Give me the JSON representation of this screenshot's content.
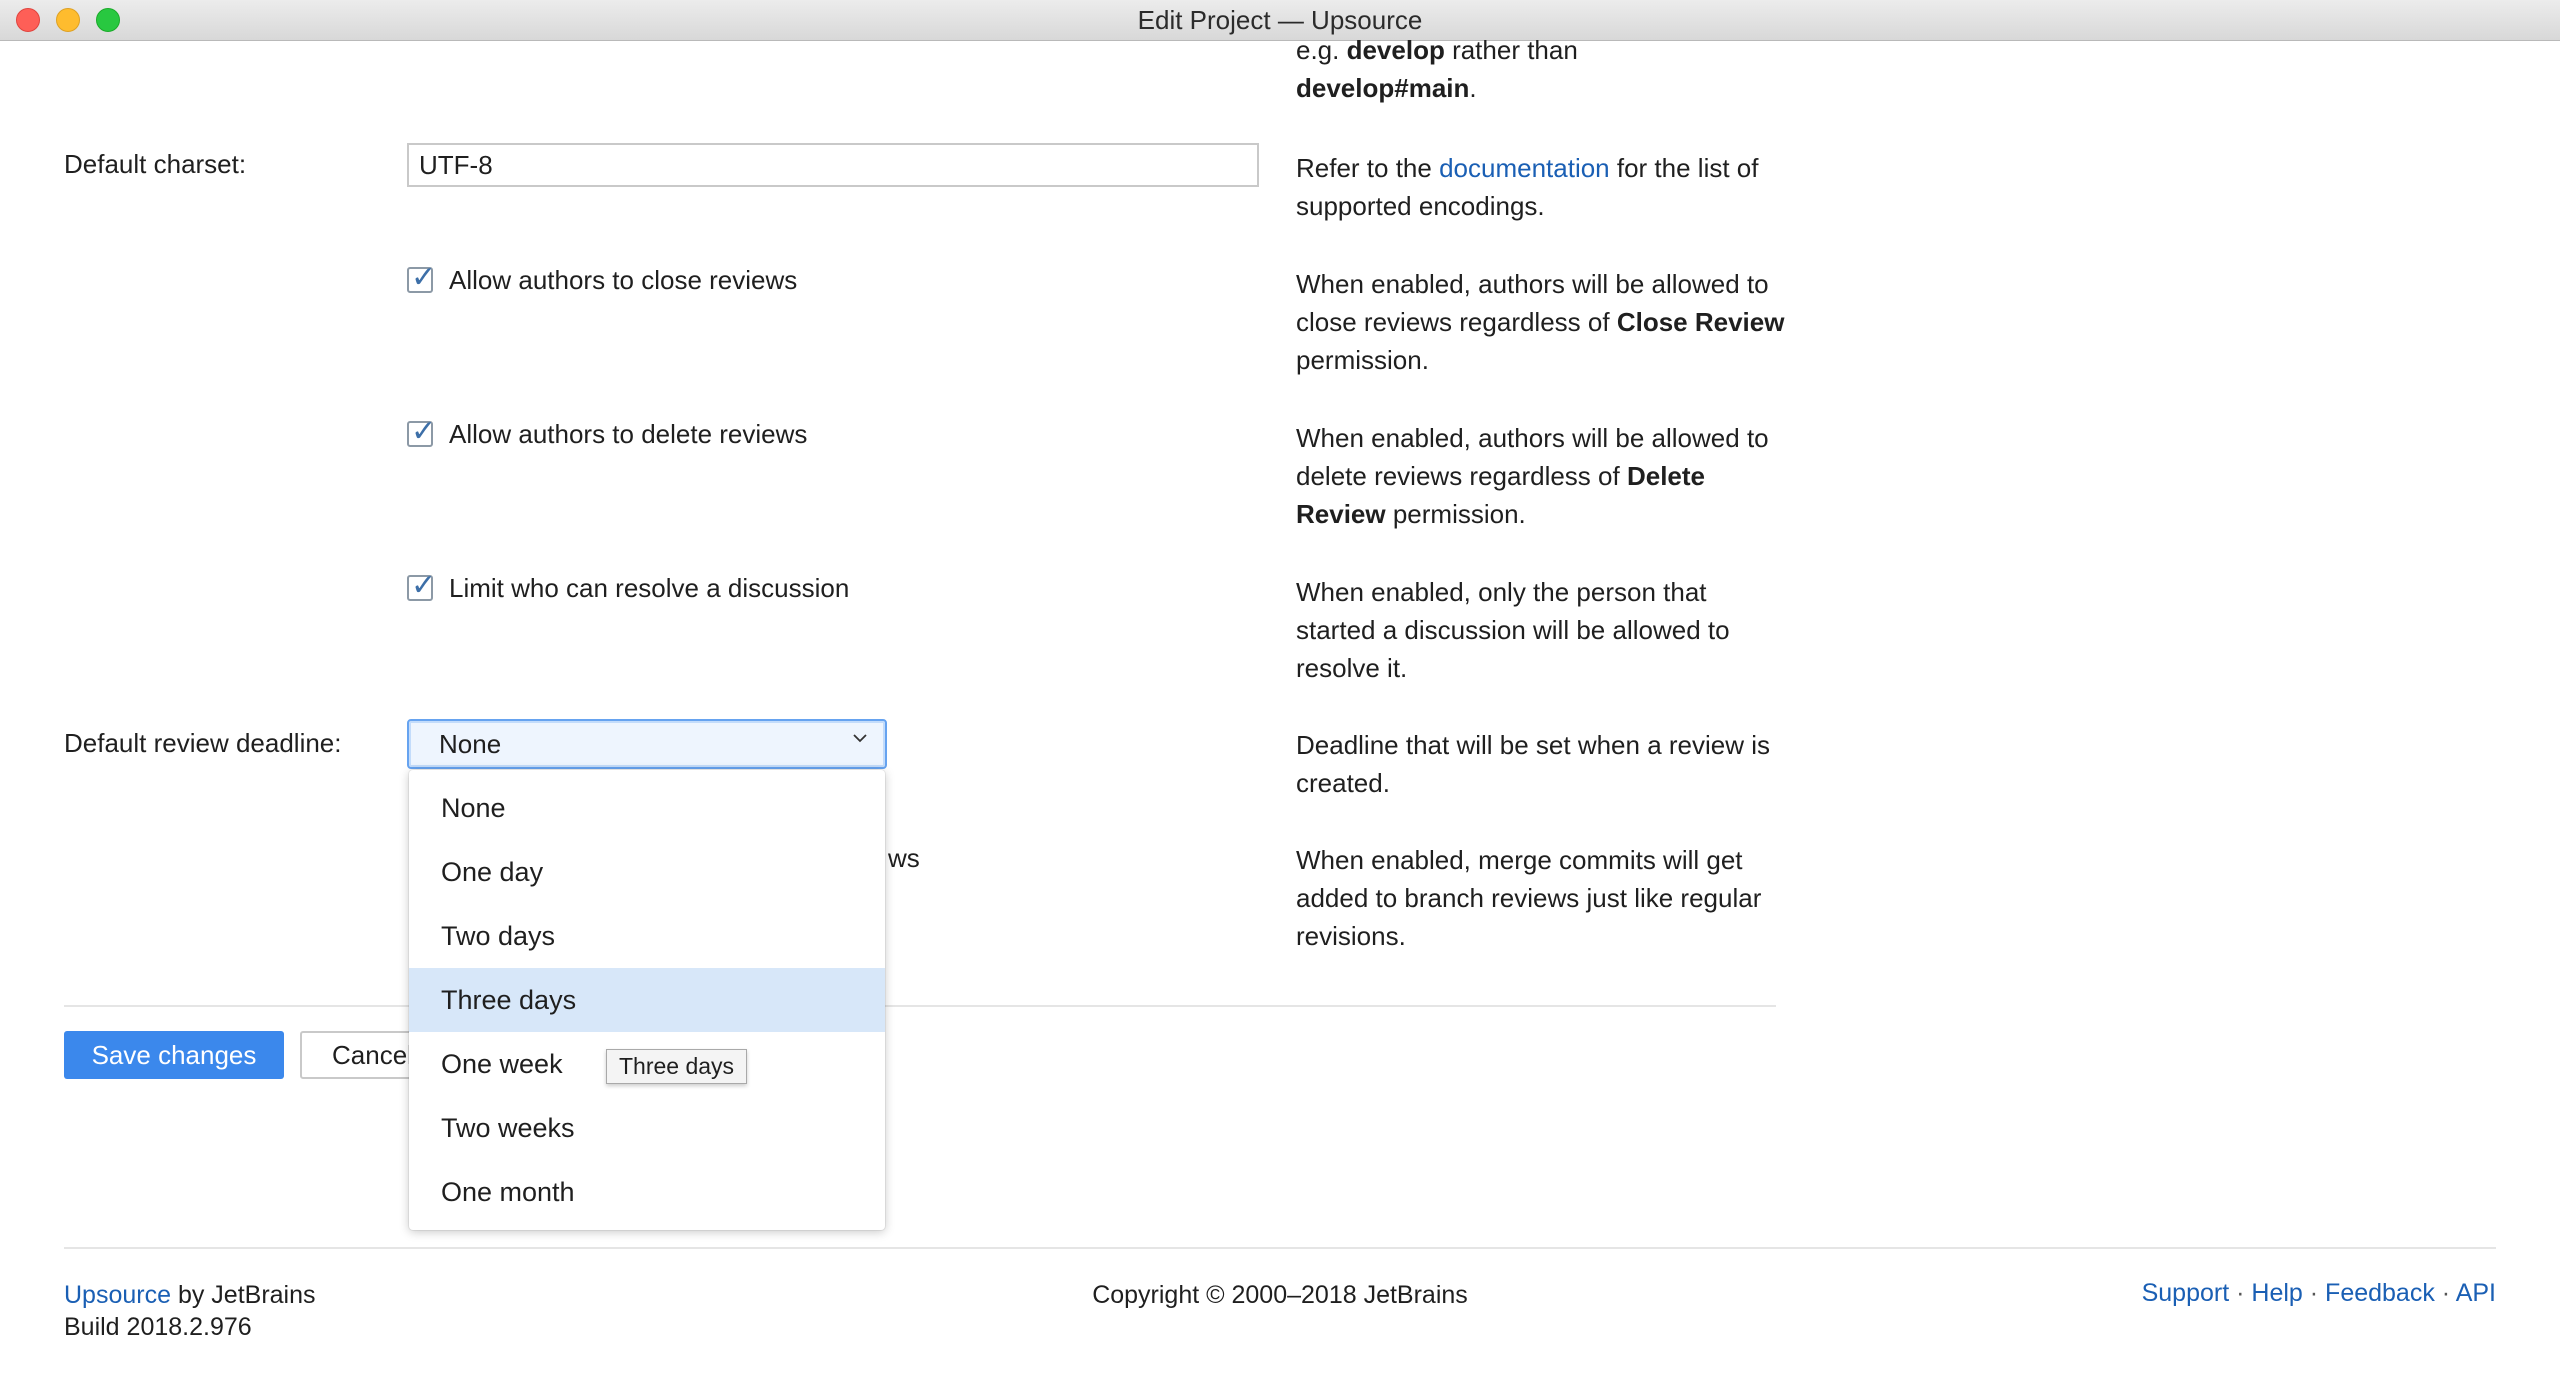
{
  "window": {
    "title": "Edit Project — Upsource"
  },
  "branch_help": {
    "prefix": "e.g. ",
    "bold1": "develop",
    "middle": " rather than",
    "bold2": "develop#main",
    "suffix": "."
  },
  "charset": {
    "label": "Default charset:",
    "value": "UTF-8",
    "help_prefix": "Refer to the ",
    "help_link": "documentation",
    "help_suffix": " for the list of supported encodings."
  },
  "options": [
    {
      "label": "Allow authors to close reviews",
      "checked": true,
      "help_pre": "When enabled, authors will be allowed to close reviews regardless of ",
      "help_bold": "Close Review",
      "help_post": " permission."
    },
    {
      "label": "Allow authors to delete reviews",
      "checked": true,
      "help_pre": "When enabled, authors will be allowed to delete reviews regardless of ",
      "help_bold": "Delete Review",
      "help_post": " permission."
    },
    {
      "label": "Limit who can resolve a discussion",
      "checked": true,
      "help_pre": "When enabled, only the person that started a discussion will be allowed to resolve it.",
      "help_bold": "",
      "help_post": ""
    }
  ],
  "deadline": {
    "label": "Default review deadline:",
    "selected": "None",
    "help": "Deadline that will be set when a review is created.",
    "options": [
      "None",
      "One day",
      "Two days",
      "Three days",
      "One week",
      "Two weeks",
      "One month"
    ],
    "highlighted": "Three days",
    "tooltip": "Three days"
  },
  "merge_option": {
    "visible_label_fragment": "ws",
    "help": "When enabled, merge commits will get added to branch reviews just like regular revisions."
  },
  "actions": {
    "save": "Save changes",
    "cancel": "Cancel"
  },
  "footer": {
    "product_link": "Upsource",
    "by": " by JetBrains",
    "build": "Build 2018.2.976",
    "copyright": "Copyright © 2000–2018 JetBrains",
    "links": [
      "Support",
      "Help",
      "Feedback",
      "API"
    ],
    "separator": "·"
  },
  "colors": {
    "accent": "#3b88ec",
    "link": "#1a5fb4",
    "highlight": "#d7e7f9"
  },
  "icons": {
    "check": "checkmark-icon",
    "dropdown": "chevron-down-icon"
  }
}
